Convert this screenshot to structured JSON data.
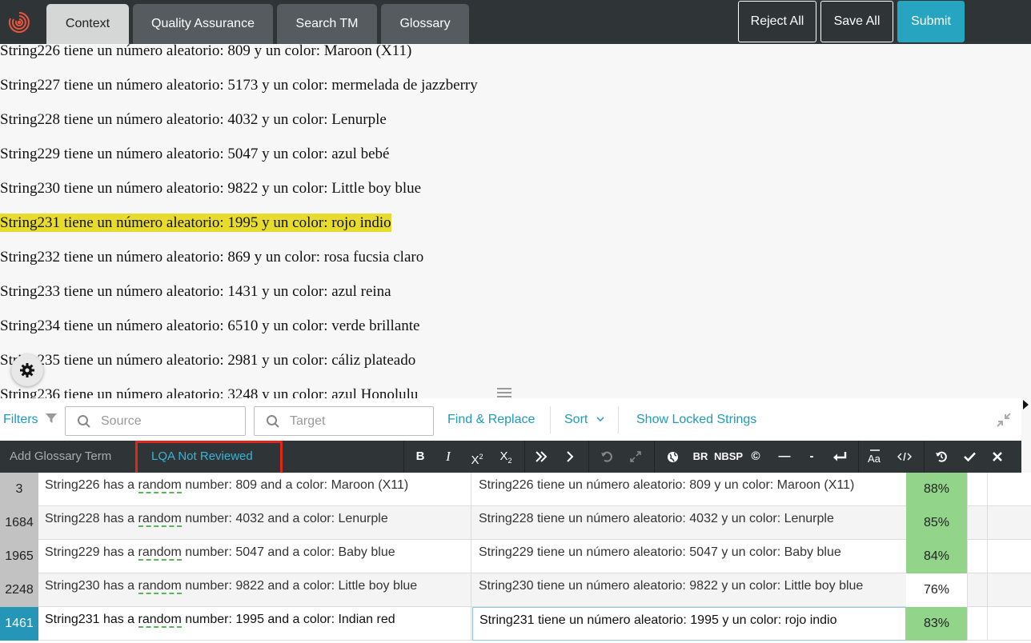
{
  "tabs": [
    {
      "label": "Context",
      "active": true
    },
    {
      "label": "Quality Assurance",
      "active": false
    },
    {
      "label": "Search TM",
      "active": false
    },
    {
      "label": "Glossary",
      "active": false
    }
  ],
  "actions": {
    "reject_all": "Reject All",
    "save_all": "Save All",
    "submit": "Submit"
  },
  "context_lines": [
    "String226 tiene un número aleatorio: 809 y un color: Maroon (X11)",
    "String227 tiene un número aleatorio: 5173 y un color: mermelada de jazzberry",
    "String228 tiene un número aleatorio: 4032 y un color: Lenurple",
    "String229 tiene un número aleatorio: 5047 y un color: azul bebé",
    "String230 tiene un número aleatorio: 9822 y un color: Little boy blue",
    "String231 tiene un número aleatorio: 1995 y un color: rojo indio",
    "String232 tiene un número aleatorio: 869 y un color: rosa fucsia claro",
    "String233 tiene un número aleatorio: 1431 y un color: azul reina",
    "String234 tiene un número aleatorio: 6510 y un color: verde brillante",
    "String235 tiene un número aleatorio: 2981 y un color: cáliz plateado",
    "String236 tiene un número aleatorio: 3248 y un color: azul Honolulu"
  ],
  "toolbar": {
    "filters": "Filters",
    "source_placeholder": "Source",
    "target_placeholder": "Target",
    "find_replace": "Find & Replace",
    "sort": "Sort",
    "show_locked": "Show Locked Strings"
  },
  "editor_bar": {
    "add_glossary": "Add Glossary Term",
    "lqa_status": "LQA Not Reviewed",
    "bold": "B",
    "italic": "I",
    "br": "BR",
    "nbsp": "NBSP",
    "copyright": "©",
    "em_dash": "—",
    "hyphen": "-"
  },
  "rows": [
    {
      "id": "3",
      "src_pre": "String226 has a ",
      "src_term": "random",
      "src_post": " number: 809 and a color: Maroon (X11)",
      "target": "String226 tiene un número aleatorio: 809 y un color: Maroon (X11)",
      "match": "88%"
    },
    {
      "id": "1684",
      "src_pre": "String228 has a ",
      "src_term": "random",
      "src_post": " number: 4032 and a color: Lenurple",
      "target": "String228 tiene un número aleatorio: 4032 y un color: Lenurple",
      "match": "85%"
    },
    {
      "id": "1965",
      "src_pre": "String229 has a ",
      "src_term": "random",
      "src_post": " number: 5047 and a color: Baby blue",
      "target": "String229 tiene un número aleatorio: 5047 y un color: Baby blue",
      "match": "84%"
    },
    {
      "id": "2248",
      "src_pre": "String230 has a ",
      "src_term": "random",
      "src_post": " number: 9822 and a color: Little boy blue",
      "target": "String230 tiene un número aleatorio: 9822 y un color: Little boy blue",
      "match": "76%"
    },
    {
      "id": "1461",
      "src_pre": "String231 has a ",
      "src_term": "random",
      "src_post": " number: 1995 and a color: Indian red",
      "target": "String231 tiene un número aleatorio: 1995 y un color: rojo indio",
      "match": "83%"
    }
  ],
  "colors": {
    "accent": "#27a4c0",
    "highlight": "#e7db2e",
    "match_good": "#92d48a",
    "lqa_border": "#e0261c"
  }
}
